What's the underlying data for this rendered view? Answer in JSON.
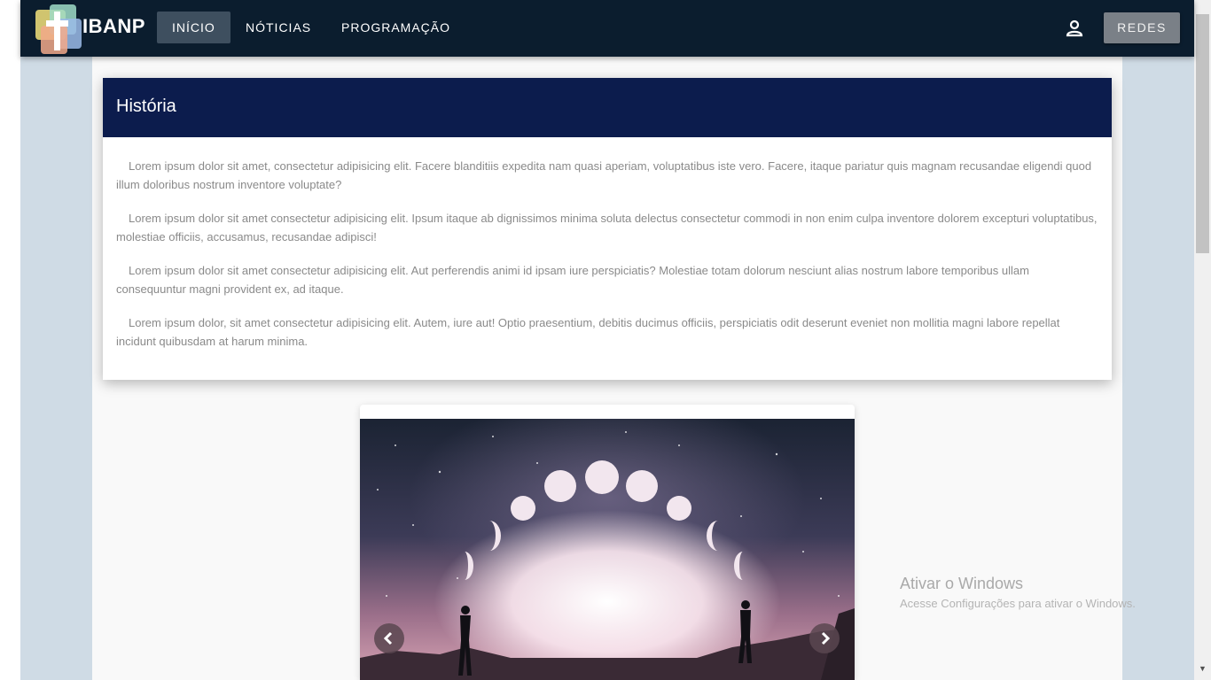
{
  "navbar": {
    "brand": "IBANP",
    "items": [
      {
        "label": "INÍCIO",
        "active": true
      },
      {
        "label": "NÓTICIAS",
        "active": false
      },
      {
        "label": "PROGRAMAÇÃO",
        "active": false
      }
    ],
    "user_icon": "user-icon",
    "redes_label": "REDES"
  },
  "history": {
    "title": "História",
    "paragraphs": [
      "Lorem ipsum dolor sit amet, consectetur adipisicing elit. Facere blanditiis expedita nam quasi aperiam, voluptatibus iste vero. Facere, itaque pariatur quis magnam recusandae eligendi quod illum doloribus nostrum inventore voluptate?",
      "Lorem ipsum dolor sit amet consectetur adipisicing elit. Ipsum itaque ab dignissimos minima soluta delectus consectetur commodi in non enim culpa inventore dolorem excepturi voluptatibus, molestiae officiis, accusamus, recusandae adipisci!",
      "Lorem ipsum dolor sit amet consectetur adipisicing elit. Aut perferendis animi id ipsam iure perspiciatis? Molestiae totam dolorum nesciunt alias nostrum labore temporibus ullam consequuntur magni provident ex, ad itaque.",
      "Lorem ipsum dolor, sit amet consectetur adipisicing elit. Autem, iure aut! Optio praesentium, debitis ducimus officiis, perspiciatis odit deserunt eveniet non mollitia magni labore repellat incidunt quibusdam at harum minima."
    ]
  },
  "carousel": {
    "prev_icon": "chevron-left-icon",
    "next_icon": "chevron-right-icon"
  },
  "watermark": {
    "title": "Ativar o Windows",
    "subtitle": "Acesse Configurações para ativar o Windows."
  },
  "colors": {
    "navbar": "#0b1d2e",
    "card_header": "#0c1c4d",
    "page_bg": "#cfdbe5",
    "active_nav": "#3e4f5f",
    "redes_button": "#7a8087"
  }
}
